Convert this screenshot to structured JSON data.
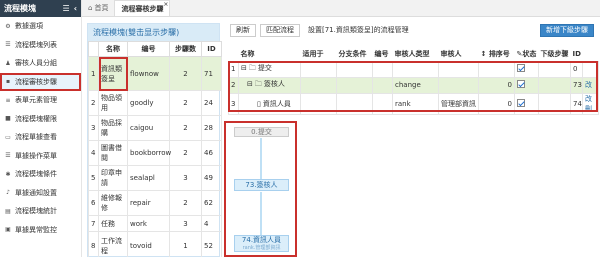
{
  "sidebar": {
    "title": "流程模塊",
    "items": [
      {
        "label": "數據選項",
        "icon": "gear-icon"
      },
      {
        "label": "流程模塊列表",
        "icon": "list-icon"
      },
      {
        "label": "審核人員分組",
        "icon": "user-group-icon"
      },
      {
        "label": "流程審核步驟",
        "icon": "steps-icon"
      },
      {
        "label": "表單元素管理",
        "icon": "sliders-icon"
      },
      {
        "label": "流程模塊權限",
        "icon": "lock-icon"
      },
      {
        "label": "流程單據查看",
        "icon": "document-icon"
      },
      {
        "label": "單據操作菜單",
        "icon": "menu-icon"
      },
      {
        "label": "流程模塊條件",
        "icon": "filter-icon"
      },
      {
        "label": "單據通知設置",
        "icon": "bell-icon"
      },
      {
        "label": "流程模塊統計",
        "icon": "chart-icon"
      },
      {
        "label": "單據異常監控",
        "icon": "monitor-icon"
      }
    ]
  },
  "tabs": {
    "home": "首頁",
    "active": "流程審核步驟"
  },
  "module_panel": {
    "title": "流程模塊(雙击显示步驟)",
    "headers": [
      "名称",
      "编号",
      "步驟数",
      "ID"
    ],
    "rows": [
      {
        "name": "資訊類簽呈",
        "code": "flownow",
        "steps": "2",
        "id": "71"
      },
      {
        "name": "物品領用",
        "code": "goodly",
        "steps": "2",
        "id": "24"
      },
      {
        "name": "物品採購",
        "code": "caigou",
        "steps": "2",
        "id": "28"
      },
      {
        "name": "圖書借閱",
        "code": "bookborrow",
        "steps": "2",
        "id": "46"
      },
      {
        "name": "印章申請",
        "code": "sealapl",
        "steps": "3",
        "id": "49"
      },
      {
        "name": "維修報修",
        "code": "repair",
        "steps": "2",
        "id": "62"
      },
      {
        "name": "任務",
        "code": "work",
        "steps": "3",
        "id": "4"
      },
      {
        "name": "工作流程",
        "code": "tovoid",
        "steps": "1",
        "id": "52"
      }
    ]
  },
  "toolbar": {
    "refresh": "刷新",
    "match": "匹配流程",
    "info": "設置[71.資訊類簽呈]的流程管理",
    "add": "新增下級步驟"
  },
  "steps_grid": {
    "headers": [
      "",
      "名称",
      "适用于",
      "分支条件",
      "编号",
      "审核人类型",
      "审核人",
      "排序号",
      "状态",
      "下级步骤",
      "ID",
      ""
    ],
    "rows": [
      {
        "num": "1",
        "name": "提交",
        "type": "",
        "person": "",
        "sort": "",
        "id": "0",
        "action": ""
      },
      {
        "num": "2",
        "name": "簽核人",
        "type": "change",
        "person": "",
        "sort": "0",
        "id": "73",
        "action": "改"
      },
      {
        "num": "3",
        "name": "資訊人員",
        "type": "rank",
        "person": "管理部資訊",
        "sort": "0",
        "id": "74",
        "action": "改 刪"
      }
    ]
  },
  "flow": {
    "start": "0.提交",
    "node1": "73.簽核人",
    "node2": "74.資訊人員",
    "node2_sub": "rank.管理部資訊"
  }
}
